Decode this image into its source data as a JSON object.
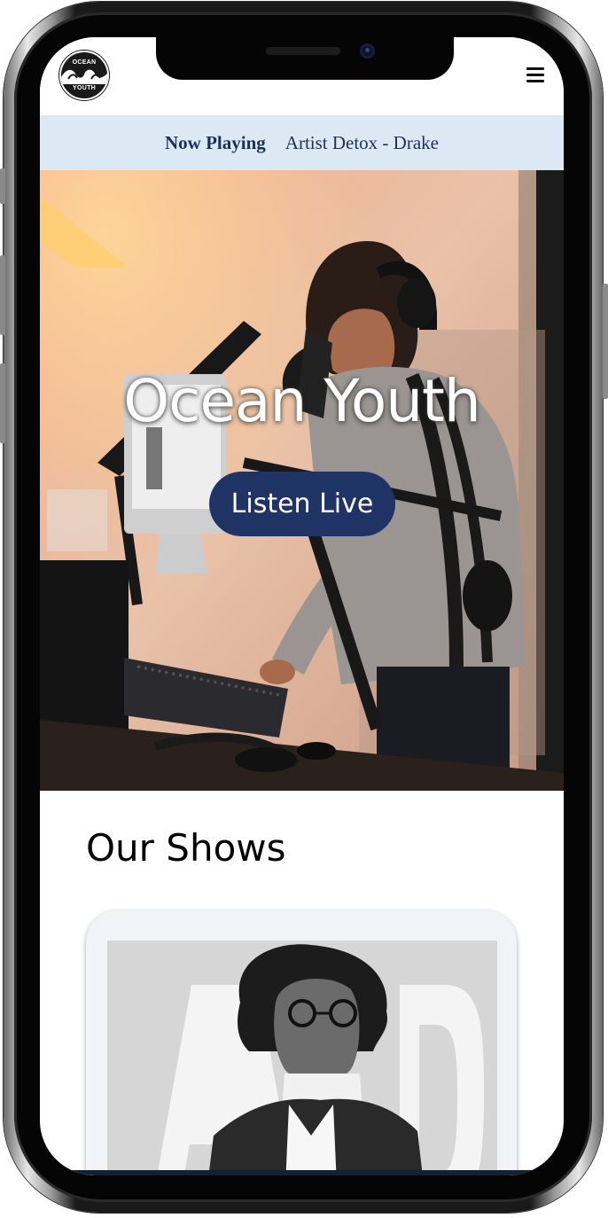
{
  "header": {
    "logo_top": "OCEAN",
    "logo_bottom": "YOUTH",
    "menu_icon": "hamburger-icon"
  },
  "now_playing": {
    "label": "Now Playing",
    "track": "Artist Detox - Drake"
  },
  "hero": {
    "title": "Ocean Youth",
    "cta_label": "Listen Live"
  },
  "shows": {
    "heading": "Our Shows"
  },
  "colors": {
    "brand_navy": "#1f3364",
    "now_playing_bg": "#dde8f5",
    "now_playing_text": "#1e2f5a"
  }
}
